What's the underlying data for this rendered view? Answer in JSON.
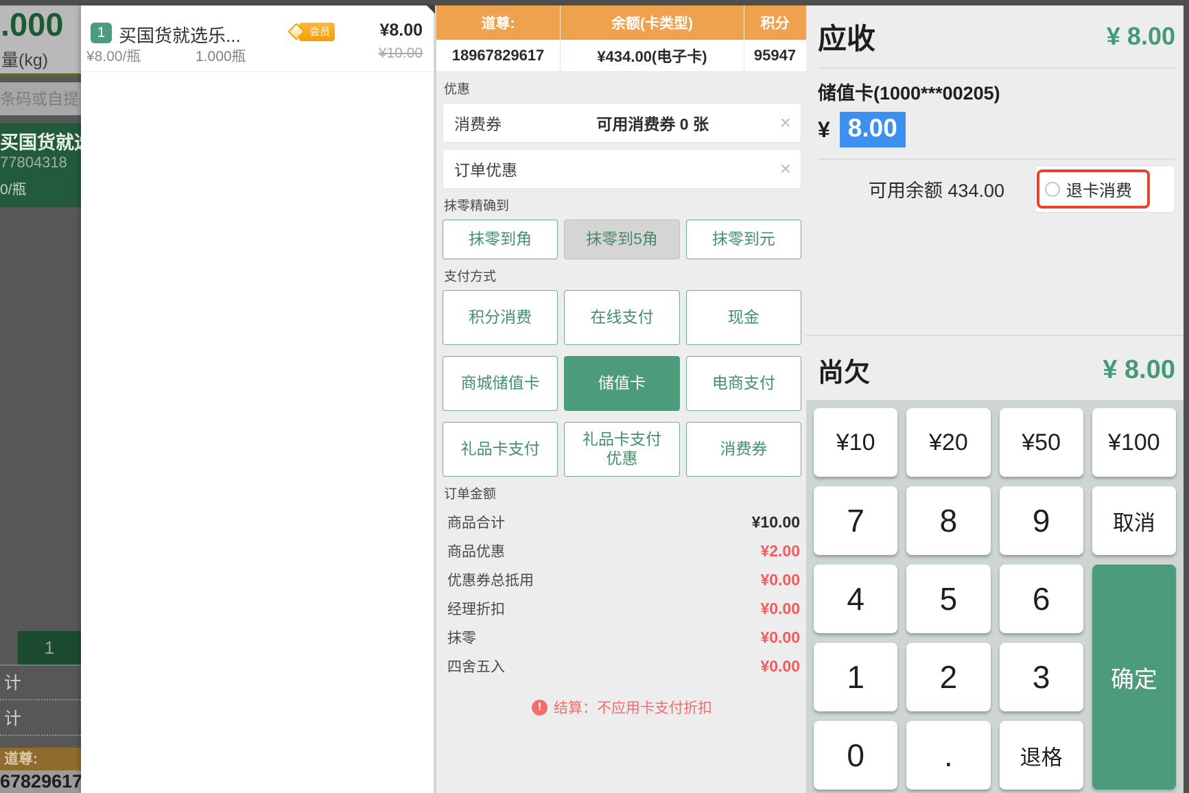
{
  "background_left": {
    "weight_value": ".000",
    "weight_unit": "量(kg)",
    "scan_placeholder": "条码或自提",
    "promo_name": "买国货就选",
    "promo_code": "77804318",
    "promo_unit": "0/瓶",
    "qty_cell": "1",
    "subtotal_partial_1": "计",
    "subtotal_partial_2": "计",
    "member_label": "道尊:",
    "member_phone_partial": "67829617"
  },
  "cart": {
    "item": {
      "index": "1",
      "name": "买国货就选乐...",
      "badge": "会员",
      "price": "¥8.00",
      "original_price": "¥10.00",
      "unit_price": "¥8.00/瓶",
      "quantity": "1.000瓶"
    }
  },
  "member": {
    "header": {
      "name": "道尊:",
      "balance": "余额(卡类型)",
      "points": "积分"
    },
    "row": {
      "name": "18967829617",
      "balance": "¥434.00(电子卡)",
      "points": "95947"
    }
  },
  "discount": {
    "title": "优惠",
    "coupon_label": "消费券",
    "coupon_info": "可用消费券 0 张",
    "order_label": "订单优惠",
    "close_icon": "×"
  },
  "rounding": {
    "title": "抹零精确到",
    "to_jiao": "抹零到角",
    "to_5jiao": "抹零到5角",
    "to_yuan": "抹零到元",
    "selected": "抹零到5角"
  },
  "payment": {
    "title": "支付方式",
    "m1": "积分消费",
    "m2": "在线支付",
    "m3": "现金",
    "m4": "商城储值卡",
    "m5": "储值卡",
    "m6": "电商支付",
    "m7": "礼品卡支付",
    "m8": "礼品卡支付优惠",
    "m9": "消费券",
    "selected": "储值卡"
  },
  "order": {
    "title": "订单金额",
    "r1_label": "商品合计",
    "r1_value": "¥10.00",
    "r2_label": "商品优惠",
    "r2_value": "¥2.00",
    "r3_label": "优惠券总抵用",
    "r3_value": "¥0.00",
    "r4_label": "经理折扣",
    "r4_value": "¥0.00",
    "r5_label": "抹零",
    "r5_value": "¥0.00",
    "r6_label": "四舍五入",
    "r6_value": "¥0.00",
    "warning_icon": "!",
    "warning": "结算：不应用卡支付折扣"
  },
  "checkout": {
    "receivable_label": "应收",
    "receivable_amount": "¥ 8.00",
    "card_title": "储值卡(1000***00205)",
    "currency": "¥",
    "amount_input": "8.00",
    "balance": "可用余额 434.00",
    "refund_label": "退卡消费",
    "due_label": "尚欠",
    "due_amount": "¥ 8.00"
  },
  "numpad": {
    "cash10": "¥10",
    "cash20": "¥20",
    "cash50": "¥50",
    "cash100": "¥100",
    "k7": "7",
    "k8": "8",
    "k9": "9",
    "cancel": "取消",
    "k4": "4",
    "k5": "5",
    "k6": "6",
    "confirm": "确定",
    "k1": "1",
    "k2": "2",
    "k3": "3",
    "k0": "0",
    "dot": ".",
    "backspace": "退格"
  },
  "colors": {
    "accent_green": "#4C9B7B",
    "amount_green": "#459A76",
    "header_orange": "#EFA24E",
    "alert_red": "#F55B5B",
    "selection_blue": "#3D8FF0",
    "highlight_red_border": "#E8432F"
  }
}
